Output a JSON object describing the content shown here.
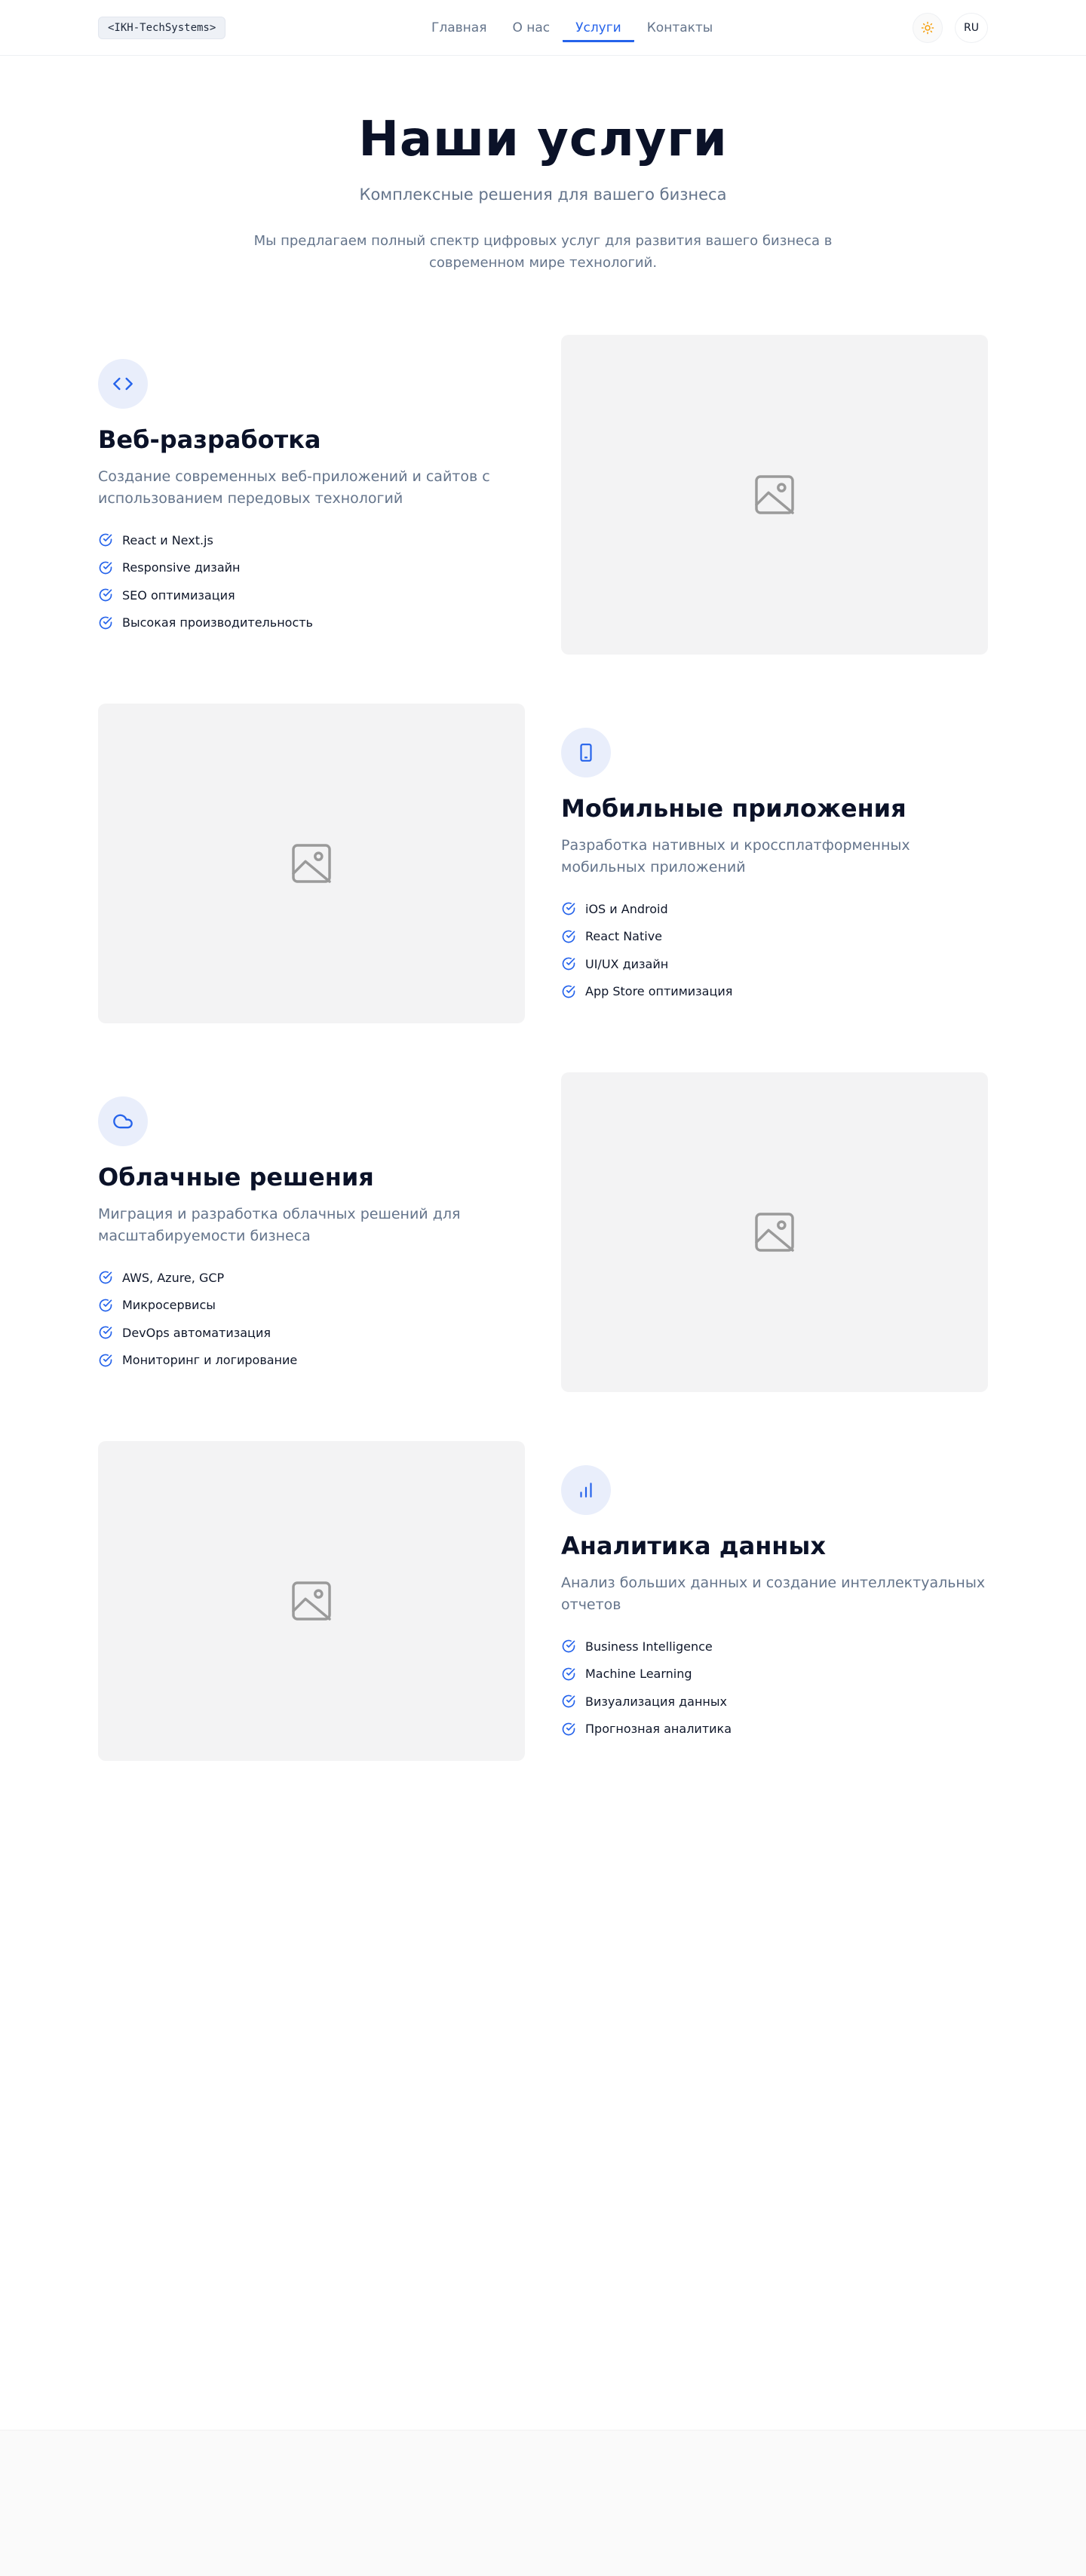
{
  "header": {
    "logo": "<IKH-TechSystems>",
    "nav": [
      {
        "label": "Главная",
        "active": false
      },
      {
        "label": "О нас",
        "active": false
      },
      {
        "label": "Услуги",
        "active": true
      },
      {
        "label": "Контакты",
        "active": false
      }
    ],
    "theme_icon": "sun-icon",
    "language": "RU"
  },
  "hero": {
    "title": "Наши услуги",
    "subtitle": "Комплексные решения для вашего бизнеса",
    "description": "Мы предлагаем полный спектр цифровых услуг для развития вашего бизнеса в современном мире технологий."
  },
  "services": [
    {
      "icon": "code-icon",
      "title": "Веб-разработка",
      "description": "Создание современных веб-приложений и сайтов с использованием передовых технологий",
      "features": [
        "React и Next.js",
        "Responsive дизайн",
        "SEO оптимизация",
        "Высокая производительность"
      ]
    },
    {
      "icon": "smartphone-icon",
      "title": "Мобильные приложения",
      "description": "Разработка нативных и кроссплатформенных мобильных приложений",
      "features": [
        "iOS и Android",
        "React Native",
        "UI/UX дизайн",
        "App Store оптимизация"
      ]
    },
    {
      "icon": "cloud-icon",
      "title": "Облачные решения",
      "description": "Миграция и разработка облачных решений для масштабируемости бизнеса",
      "features": [
        "AWS, Azure, GCP",
        "Микросервисы",
        "DevOps автоматизация",
        "Мониторинг и логирование"
      ]
    },
    {
      "icon": "bar-chart-icon",
      "title": "Аналитика данных",
      "description": "Анализ больших данных и создание интеллектуальных отчетов",
      "features": [
        "Business Intelligence",
        "Machine Learning",
        "Визуализация данных",
        "Прогнозная аналитика"
      ]
    }
  ],
  "colors": {
    "accent": "#2563eb",
    "heading": "#0b1228",
    "muted": "#64748b",
    "placeholder_bg": "#f3f3f4",
    "icon_bg": "#e9eefb"
  }
}
